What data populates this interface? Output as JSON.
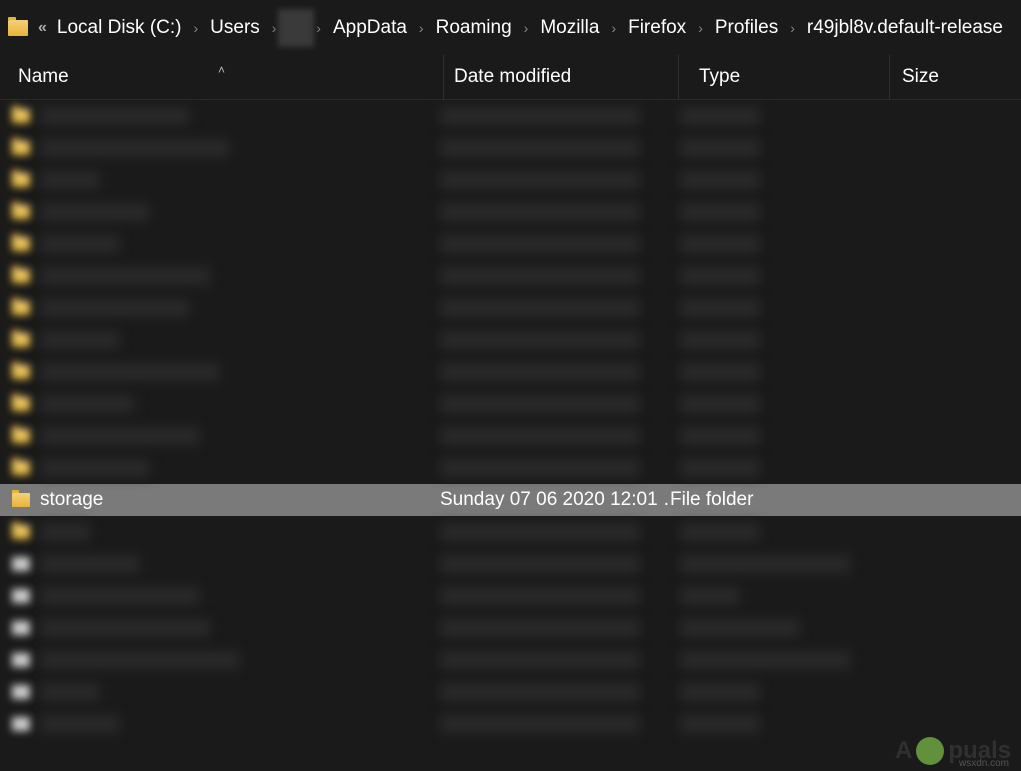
{
  "breadcrumb": {
    "chevrons": "«",
    "items": [
      {
        "label": "Local Disk (C:)"
      },
      {
        "label": "Users"
      },
      {
        "label": "",
        "obscured": true
      },
      {
        "label": "AppData"
      },
      {
        "label": "Roaming"
      },
      {
        "label": "Mozilla"
      },
      {
        "label": "Firefox"
      },
      {
        "label": "Profiles"
      },
      {
        "label": "r49jbl8v.default-release"
      }
    ]
  },
  "columns": {
    "name": "Name",
    "date": "Date modified",
    "type": "Type",
    "size": "Size",
    "sort_indicator": "˄"
  },
  "rows": [
    {
      "blurred": true,
      "name_width": 150
    },
    {
      "blurred": true,
      "name_width": 190
    },
    {
      "blurred": true,
      "name_width": 60
    },
    {
      "blurred": true,
      "name_width": 110
    },
    {
      "blurred": true,
      "name_width": 80
    },
    {
      "blurred": true,
      "name_width": 170
    },
    {
      "blurred": true,
      "name_width": 150
    },
    {
      "blurred": true,
      "name_width": 80
    },
    {
      "blurred": true,
      "name_width": 180
    },
    {
      "blurred": true,
      "name_width": 95
    },
    {
      "blurred": true,
      "name_width": 160
    },
    {
      "blurred": true,
      "name_width": 110
    },
    {
      "selected": true,
      "name": "storage",
      "date": "Sunday 07 06 2020 12:01 …",
      "type": "File folder",
      "size": ""
    },
    {
      "blurred": true,
      "name_width": 50
    },
    {
      "blurred": true,
      "name_width": 100,
      "file": true,
      "type_width": 170,
      "has_size": true
    },
    {
      "blurred": true,
      "name_width": 160,
      "file": true,
      "type_width": 60,
      "has_size": true
    },
    {
      "blurred": true,
      "name_width": 170,
      "file": true,
      "type_width": 120,
      "has_size": true
    },
    {
      "blurred": true,
      "name_width": 200,
      "file": true,
      "type_width": 170,
      "has_size": true
    },
    {
      "blurred": true,
      "name_width": 60,
      "file": true
    },
    {
      "blurred": true,
      "name_width": 80,
      "file": true
    }
  ],
  "watermark": {
    "text": "A  puals",
    "sub": "wsxdn.com"
  }
}
